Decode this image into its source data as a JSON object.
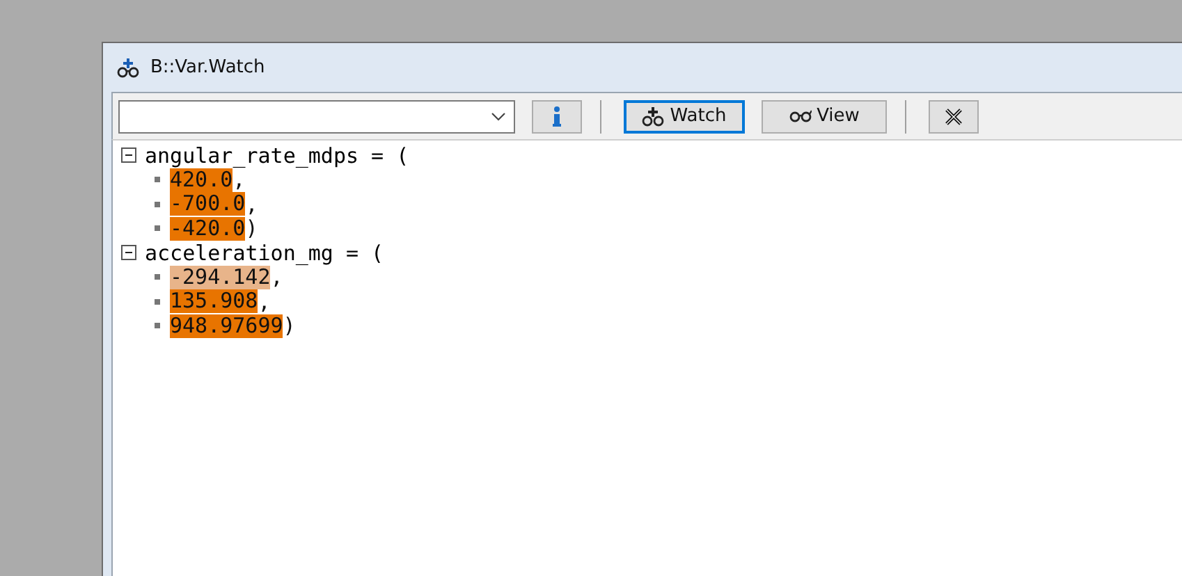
{
  "window": {
    "title": "B::Var.Watch"
  },
  "toolbar": {
    "buttons": [
      {
        "kind": "info",
        "focused": false
      },
      {
        "kind": "separator"
      },
      {
        "kind": "watch",
        "label": "Watch",
        "focused": true
      },
      {
        "kind": "view",
        "label": "View",
        "focused": false
      },
      {
        "kind": "separator"
      },
      {
        "kind": "delete",
        "focused": false
      }
    ]
  },
  "variables": [
    {
      "name": "angular_rate_mdps = (",
      "expanded": true,
      "children": [
        {
          "value": "420.0",
          "suffix": ",",
          "color": "#e87400"
        },
        {
          "value": "-700.0",
          "suffix": ",",
          "color": "#e87400"
        },
        {
          "value": "-420.0",
          "suffix": ")",
          "color": "#e87400"
        }
      ]
    },
    {
      "name": "acceleration_mg = (",
      "expanded": true,
      "children": [
        {
          "value": "-294.142",
          "suffix": ",",
          "color": "#e8b48a"
        },
        {
          "value": "135.908",
          "suffix": ",",
          "color": "#e87400"
        },
        {
          "value": "948.97699",
          "suffix": ")",
          "color": "#e87400"
        }
      ]
    }
  ]
}
